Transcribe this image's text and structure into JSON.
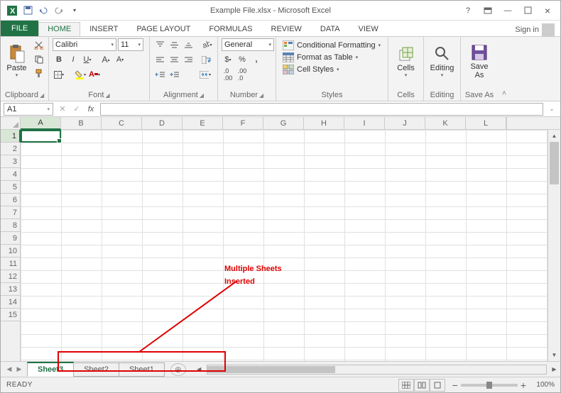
{
  "title": "Example File.xlsx - Microsoft Excel",
  "tabs": {
    "file": "FILE",
    "home": "HOME",
    "insert": "INSERT",
    "page_layout": "PAGE LAYOUT",
    "formulas": "FORMULAS",
    "review": "REVIEW",
    "data": "DATA",
    "view": "VIEW"
  },
  "signin": "Sign in",
  "clipboard_group": {
    "paste": "Paste",
    "label": "Clipboard"
  },
  "font_group": {
    "font": "Calibri",
    "size": "11",
    "label": "Font"
  },
  "alignment_group": {
    "label": "Alignment"
  },
  "number_group": {
    "format": "General",
    "label": "Number"
  },
  "styles_group": {
    "cond": "Conditional Formatting",
    "table": "Format as Table",
    "cell": "Cell Styles",
    "label": "Styles"
  },
  "cells_group": {
    "cells": "Cells",
    "label": "Cells"
  },
  "editing_group": {
    "editing": "Editing",
    "label": "Editing"
  },
  "save_group": {
    "save": "Save\nAs",
    "label": "Save As"
  },
  "namebox": "A1",
  "fx_label": "fx",
  "columns": [
    "A",
    "B",
    "C",
    "D",
    "E",
    "F",
    "G",
    "H",
    "I",
    "J",
    "K",
    "L"
  ],
  "rows": [
    "1",
    "2",
    "3",
    "4",
    "5",
    "6",
    "7",
    "8",
    "9",
    "10",
    "11",
    "12",
    "13",
    "14",
    "15"
  ],
  "sheets": [
    "Sheet3",
    "Sheet2",
    "Sheet1"
  ],
  "active_sheet": 0,
  "status": "READY",
  "zoom": "100%",
  "annotation": {
    "line1": "Multiple Sheets",
    "line2": "Inserted"
  }
}
